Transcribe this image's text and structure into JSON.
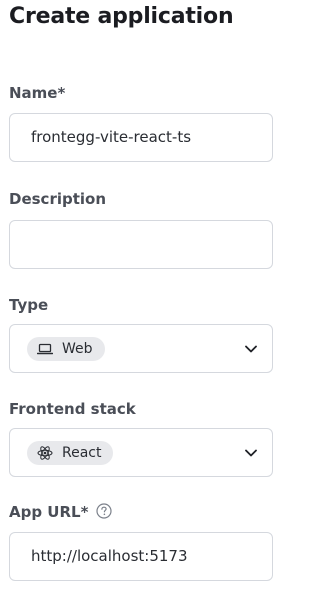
{
  "page": {
    "title": "Create application"
  },
  "form": {
    "name": {
      "label": "Name*",
      "value": "frontegg-vite-react-ts"
    },
    "description": {
      "label": "Description",
      "value": ""
    },
    "type": {
      "label": "Type",
      "selected": "Web",
      "icon": "laptop-icon"
    },
    "frontend_stack": {
      "label": "Frontend stack",
      "selected": "React",
      "icon": "react-atom-icon"
    },
    "app_url": {
      "label": "App URL*",
      "value": "http://localhost:5173",
      "help_icon": "question-circle-icon"
    }
  },
  "colors": {
    "text": "#1b1c21",
    "label": "#4a4e57",
    "border": "#d5d8de",
    "chip_bg": "#e8e9ec"
  }
}
